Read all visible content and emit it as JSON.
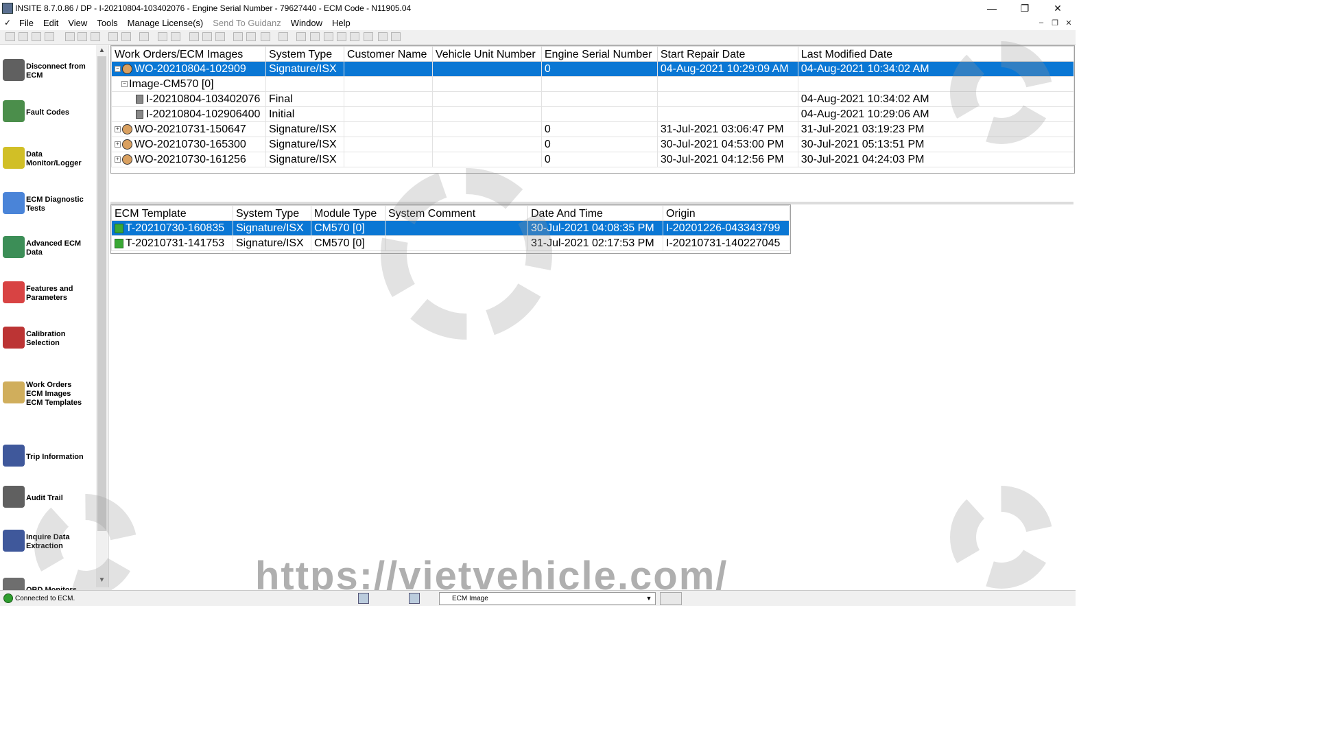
{
  "window": {
    "title": "INSITE 8.7.0.86  / DP - I-20210804-103402076 - Engine Serial Number - 79627440 - ECM Code -  N11905.04",
    "controls": {
      "minimize": "—",
      "restore": "❐",
      "close": "✕"
    }
  },
  "menu": {
    "items": [
      {
        "label": "File",
        "enabled": true
      },
      {
        "label": "Edit",
        "enabled": true
      },
      {
        "label": "View",
        "enabled": true
      },
      {
        "label": "Tools",
        "enabled": true
      },
      {
        "label": "Manage License(s)",
        "enabled": true
      },
      {
        "label": "Send To Guidanz",
        "enabled": false
      },
      {
        "label": "Window",
        "enabled": true
      },
      {
        "label": "Help",
        "enabled": true
      }
    ],
    "mdi_controls": {
      "minimize": "–",
      "restore": "❐",
      "close": "✕"
    }
  },
  "sidebar": {
    "items": [
      {
        "label": "Disconnect from\nECM",
        "icon": "disconnect-icon"
      },
      {
        "label": "Fault Codes",
        "icon": "fault-codes-icon"
      },
      {
        "label": "Data\nMonitor/Logger",
        "icon": "data-monitor-icon"
      },
      {
        "label": "ECM Diagnostic\nTests",
        "icon": "diagnostic-flask-icon"
      },
      {
        "label": "Advanced ECM\nData",
        "icon": "advanced-ecm-icon"
      },
      {
        "label": "Features and\nParameters",
        "icon": "features-icon"
      },
      {
        "label": "Calibration\nSelection",
        "icon": "calibration-icon"
      },
      {
        "label": "Work Orders\nECM Images\nECM Templates",
        "icon": "work-orders-icon"
      },
      {
        "label": "Trip Information",
        "icon": "truck-icon"
      },
      {
        "label": "Audit Trail",
        "icon": "audit-trail-icon"
      },
      {
        "label": "Inquire Data\nExtraction",
        "icon": "inquire-data-icon"
      },
      {
        "label": "OBD Monitors",
        "icon": "obd-icon"
      }
    ]
  },
  "work_orders_table": {
    "columns": [
      "Work Orders/ECM Images",
      "System Type",
      "Customer Name",
      "Vehicle Unit Number",
      "Engine Serial Number",
      "Start Repair Date",
      "Last Modified Date"
    ],
    "rows": [
      {
        "name": "WO-20210804-102909",
        "level": 0,
        "expander": "−",
        "kind": "work-order",
        "selected": true,
        "system_type": "Signature/ISX",
        "customer": "",
        "vehicle_unit": "",
        "engine_serial": "0",
        "start_date": "04-Aug-2021 10:29:09 AM",
        "modified_date": "04-Aug-2021 10:34:02 AM"
      },
      {
        "name": "Image-CM570 [0]",
        "level": 1,
        "expander": "−",
        "kind": "image-group",
        "selected": false,
        "system_type": "",
        "customer": "",
        "vehicle_unit": "",
        "engine_serial": "",
        "start_date": "",
        "modified_date": ""
      },
      {
        "name": "I-20210804-103402076",
        "level": 2,
        "expander": "",
        "kind": "image",
        "selected": false,
        "system_type": "Final",
        "customer": "",
        "vehicle_unit": "",
        "engine_serial": "",
        "start_date": "",
        "modified_date": "04-Aug-2021 10:34:02 AM"
      },
      {
        "name": "I-20210804-102906400",
        "level": 2,
        "expander": "",
        "kind": "image",
        "selected": false,
        "system_type": "Initial",
        "customer": "",
        "vehicle_unit": "",
        "engine_serial": "",
        "start_date": "",
        "modified_date": "04-Aug-2021 10:29:06 AM"
      },
      {
        "name": "WO-20210731-150647",
        "level": 0,
        "expander": "+",
        "kind": "work-order",
        "selected": false,
        "system_type": "Signature/ISX",
        "customer": "",
        "vehicle_unit": "",
        "engine_serial": "0",
        "start_date": "31-Jul-2021 03:06:47 PM",
        "modified_date": "31-Jul-2021 03:19:23 PM"
      },
      {
        "name": "WO-20210730-165300",
        "level": 0,
        "expander": "+",
        "kind": "work-order",
        "selected": false,
        "system_type": "Signature/ISX",
        "customer": "",
        "vehicle_unit": "",
        "engine_serial": "0",
        "start_date": "30-Jul-2021 04:53:00 PM",
        "modified_date": "30-Jul-2021 05:13:51 PM"
      },
      {
        "name": "WO-20210730-161256",
        "level": 0,
        "expander": "+",
        "kind": "work-order",
        "selected": false,
        "system_type": "Signature/ISX",
        "customer": "",
        "vehicle_unit": "",
        "engine_serial": "0",
        "start_date": "30-Jul-2021 04:12:56 PM",
        "modified_date": "30-Jul-2021 04:24:03 PM"
      }
    ]
  },
  "templates_table": {
    "columns": [
      "ECM Template",
      "System Type",
      "Module Type",
      "System Comment",
      "Date And Time",
      "Origin"
    ],
    "rows": [
      {
        "name": "T-20210730-160835",
        "selected": true,
        "system_type": "Signature/ISX",
        "module_type": "CM570 [0]",
        "comment": "",
        "datetime": "30-Jul-2021 04:08:35 PM",
        "origin": "I-20201226-043343799"
      },
      {
        "name": "T-20210731-141753",
        "selected": false,
        "system_type": "Signature/ISX",
        "module_type": "CM570 [0]",
        "comment": "",
        "datetime": "31-Jul-2021 02:17:53 PM",
        "origin": "I-20210731-140227045"
      }
    ]
  },
  "status": {
    "connection": "Connected to ECM.",
    "combo_value": "ECM Image",
    "connected_color": "#2e9e2e"
  },
  "watermark": {
    "url": "https://vietvehicle.com/"
  },
  "colors": {
    "selection": "#0a77d4"
  }
}
